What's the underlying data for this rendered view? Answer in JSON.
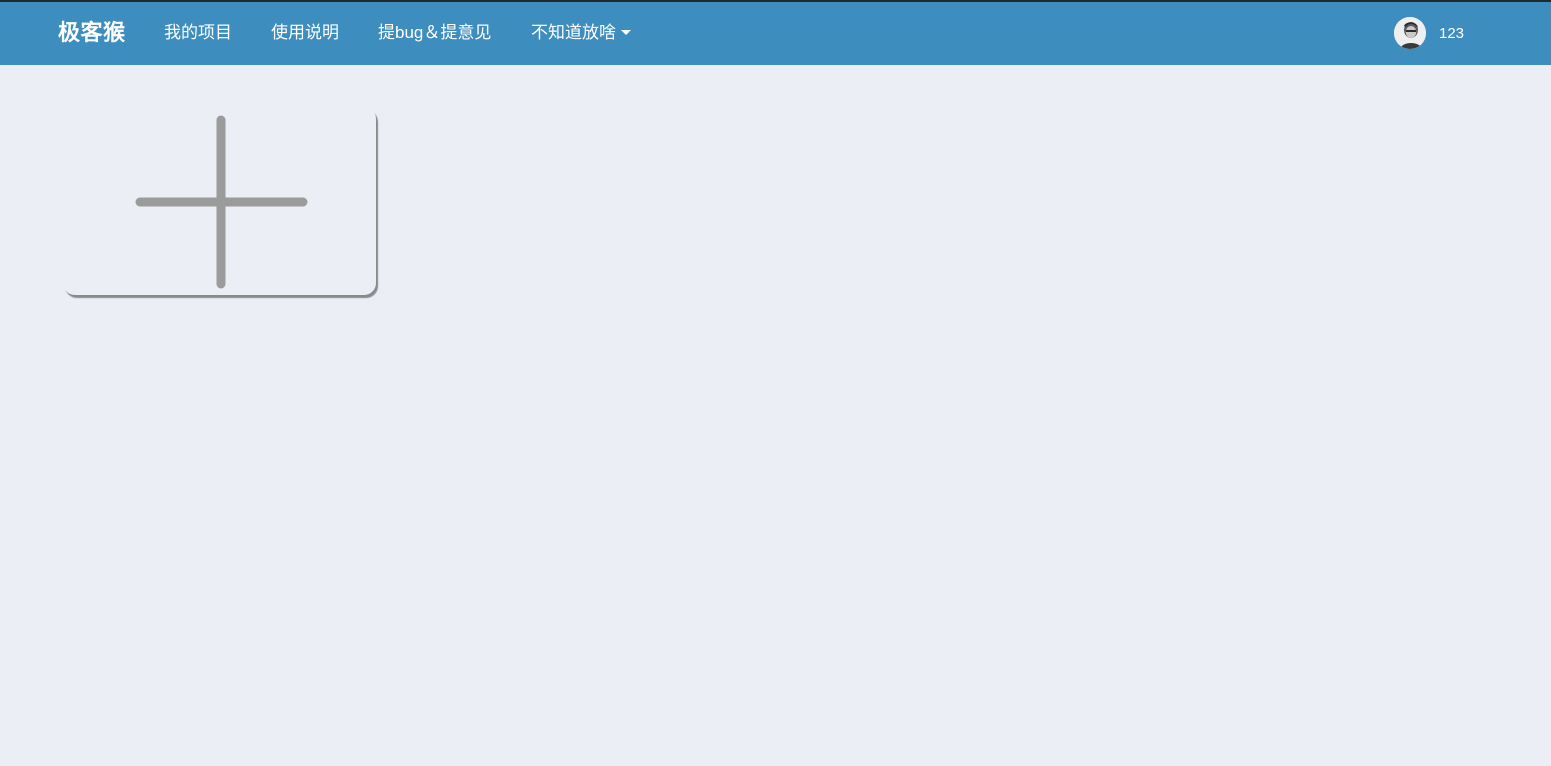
{
  "navbar": {
    "brand": "极客猴",
    "items": [
      {
        "label": "我的项目"
      },
      {
        "label": "使用说明"
      },
      {
        "label": "提bug＆提意见"
      },
      {
        "label": "不知道放啥",
        "has_dropdown": true
      }
    ],
    "user": {
      "name": "123",
      "avatar_icon": "user-avatar"
    },
    "colors": {
      "background": "#3d8dbe",
      "text": "#ffffff"
    }
  },
  "main": {
    "add_card": {
      "icon": "plus-icon",
      "color": "#9b9b9b"
    },
    "background": "#ebeef4"
  }
}
